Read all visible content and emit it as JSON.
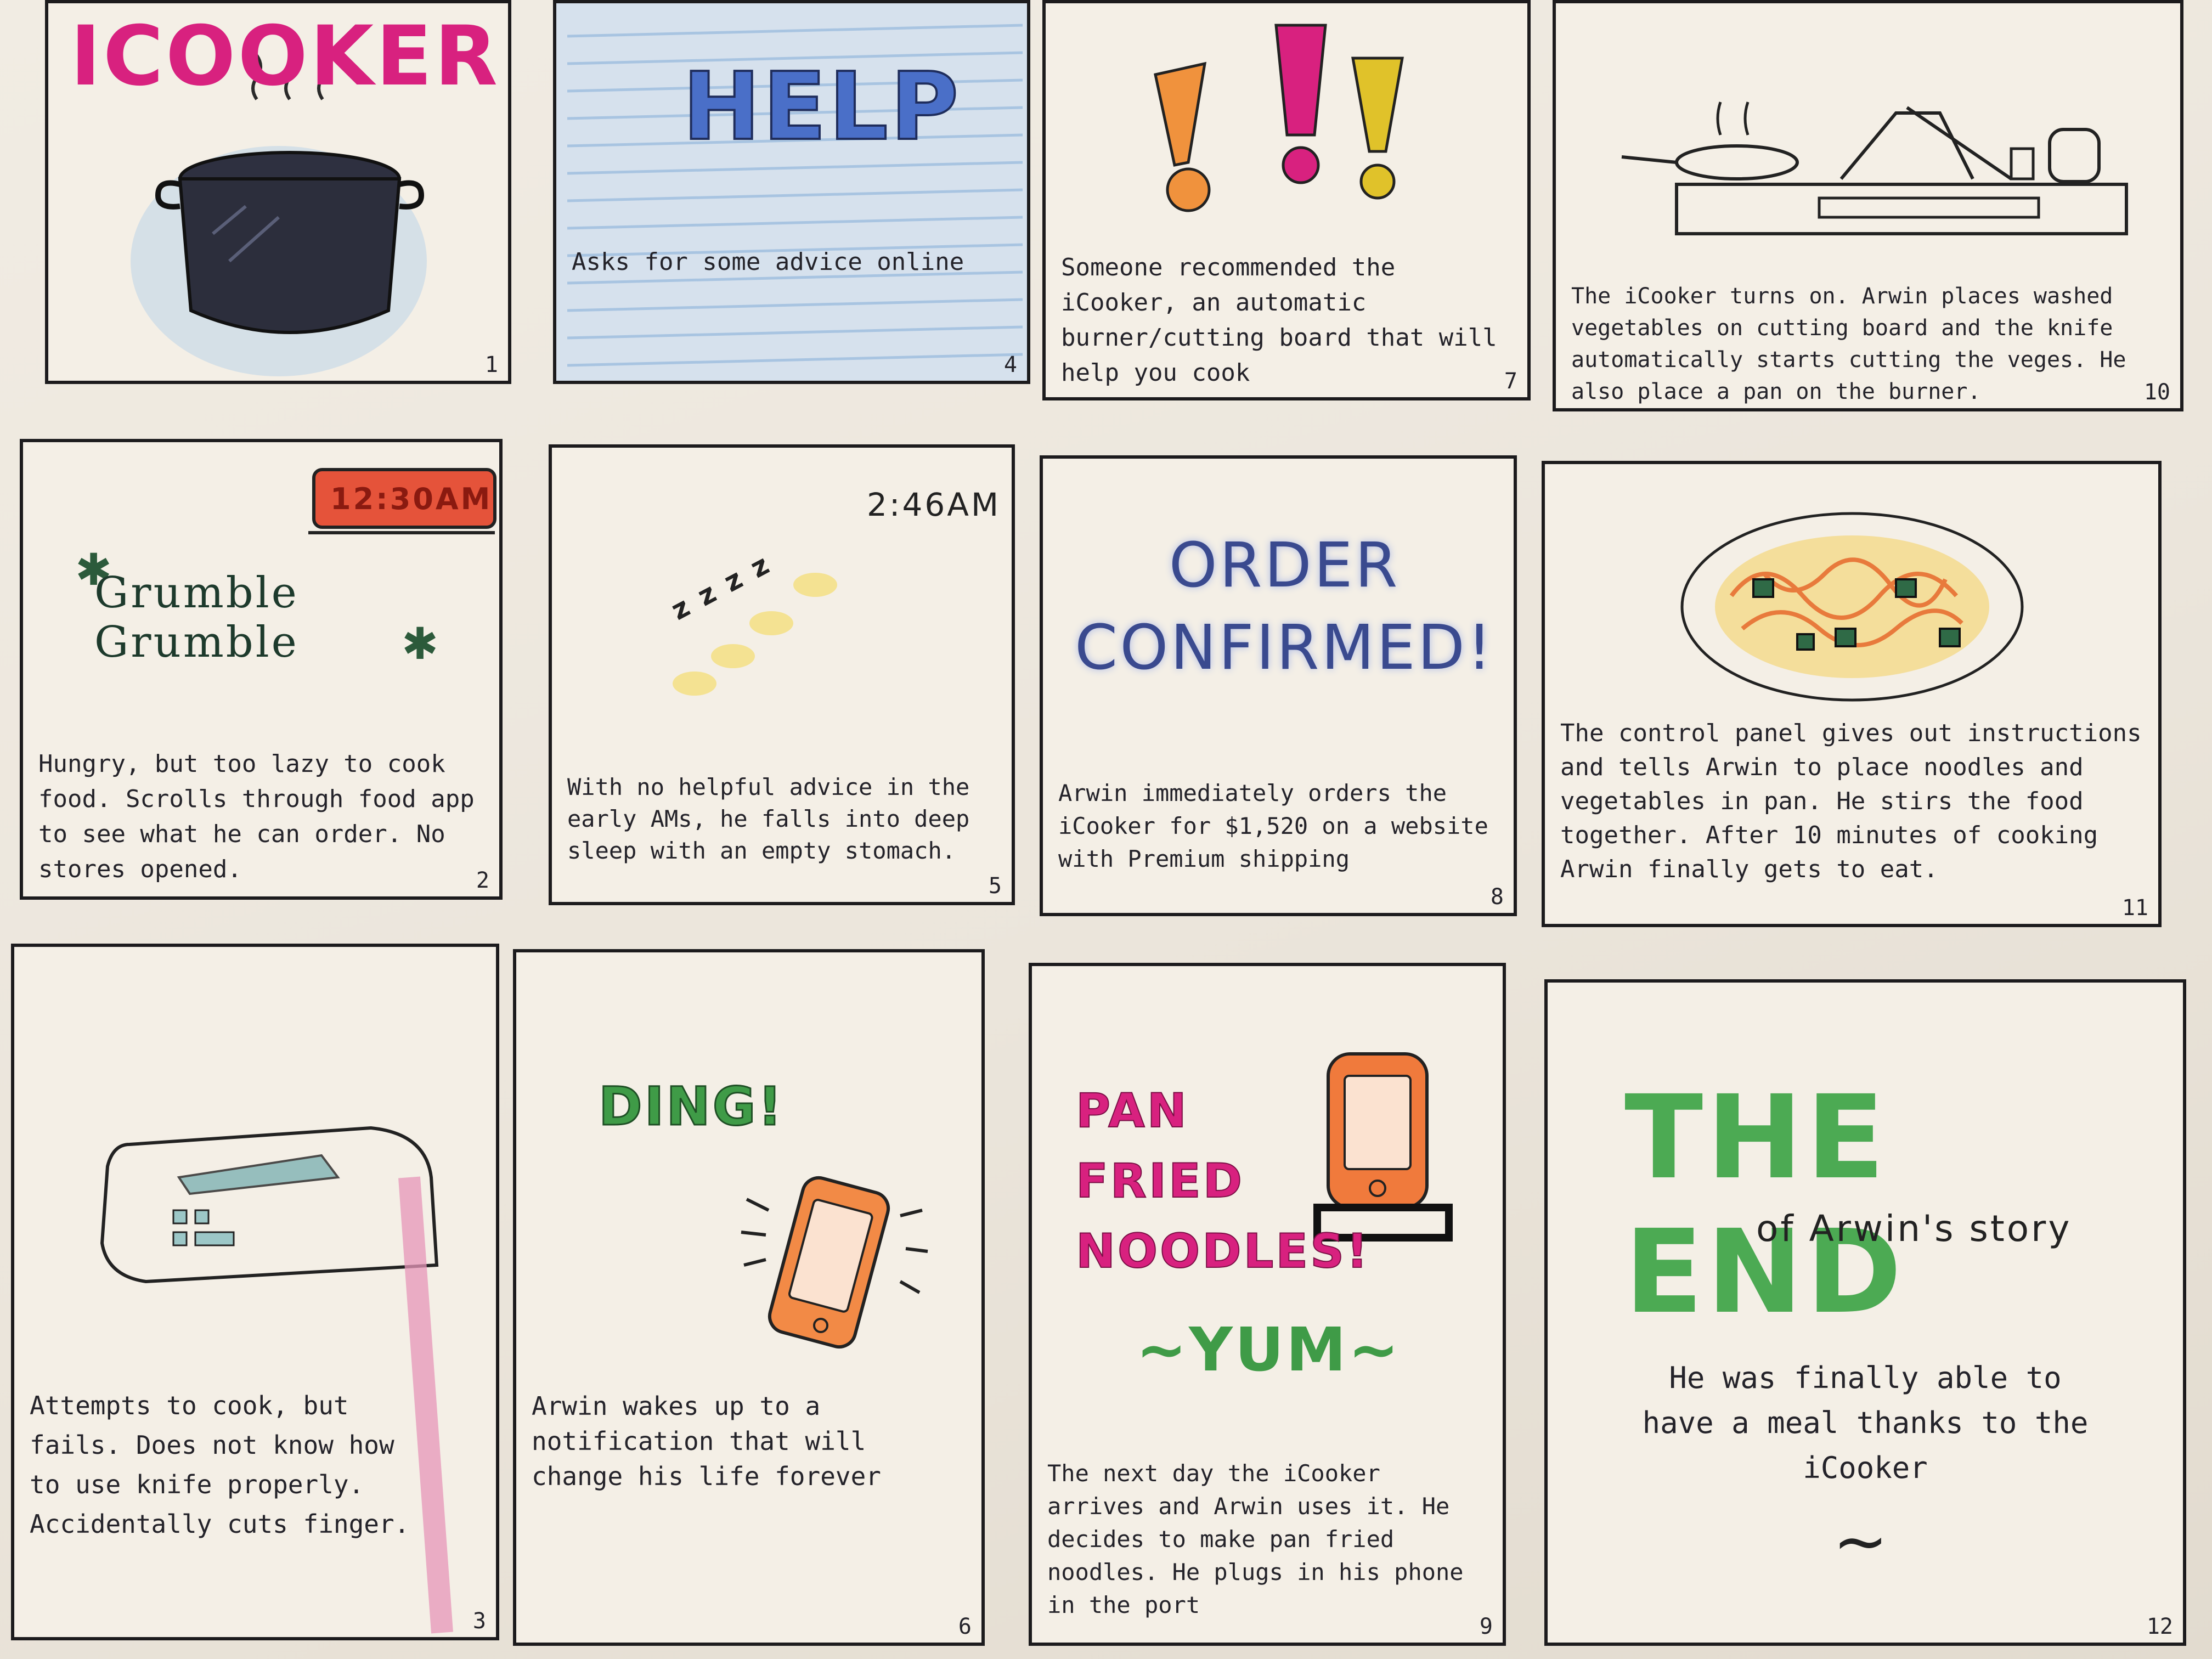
{
  "panels": [
    {
      "number": "1",
      "title": "ICOOKER",
      "caption": ""
    },
    {
      "number": "4",
      "title": "HELP",
      "caption": "Asks for some advice online"
    },
    {
      "number": "7",
      "title": "!!!",
      "caption": "Someone recommended the iCooker, an automatic burner/cutting board that will help you cook"
    },
    {
      "number": "10",
      "title": "",
      "caption": "The iCooker turns on. Arwin places washed vegetables on cutting board and the knife automatically starts cutting the veges. He also place a pan on the burner."
    },
    {
      "number": "2",
      "title": "Grumble Grumble",
      "clock": "12:30AM",
      "caption": "Hungry, but too lazy to cook food. Scrolls through food app to see what he can order. No stores opened."
    },
    {
      "number": "5",
      "title": "z z z z",
      "clock": "2:46AM",
      "caption": "With no helpful advice in the early AMs, he falls into deep sleep with an empty stomach."
    },
    {
      "number": "8",
      "title": "ORDER CONFIRMED!",
      "caption": "Arwin immediately orders the iCooker for $1,520 on a website with Premium shipping"
    },
    {
      "number": "11",
      "title": "",
      "caption": "The control panel gives out instructions and tells Arwin to place noodles and vegetables in pan. He stirs the food together. After 10 minutes of cooking Arwin finally gets to eat."
    },
    {
      "number": "3",
      "title": "",
      "caption": "Attempts to cook, but fails. Does not know how to use knife properly. Accidentally cuts finger."
    },
    {
      "number": "6",
      "title": "DING!",
      "caption": "Arwin wakes up to a notification that will change his life forever"
    },
    {
      "number": "9",
      "title": "PAN FRIED NOODLES!",
      "subtitle": "~YUM~",
      "caption": "The next day the iCooker arrives and Arwin uses it. He decides to make pan fried noodles. He plugs in his phone in the port"
    },
    {
      "number": "12",
      "title": "THE END",
      "subtitle": "of Arwin's story",
      "caption": "He was finally able to have a meal thanks to the iCooker",
      "signature": "~"
    }
  ],
  "colors": {
    "ink": "#1c1b1d",
    "pink": "#d8217f",
    "blue": "#4a6fc8",
    "orange": "#e9783a",
    "yellow": "#e0c22a",
    "green": "#3f9b47",
    "red": "#d9482f"
  }
}
